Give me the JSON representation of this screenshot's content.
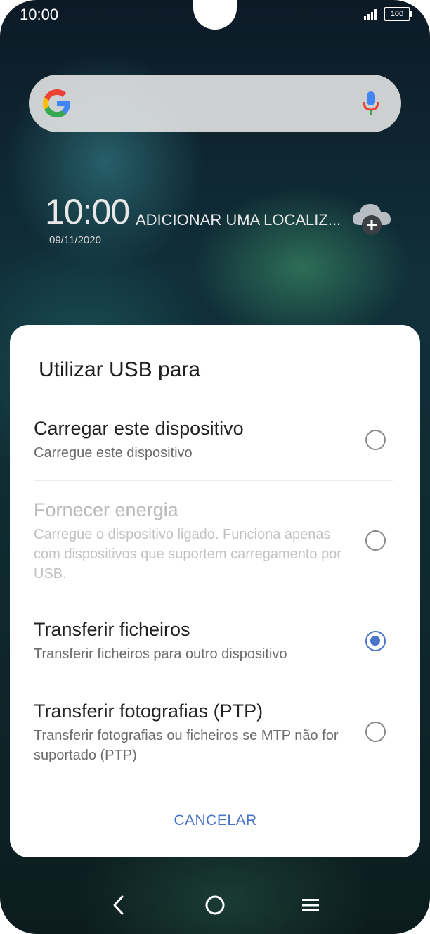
{
  "status_bar": {
    "time": "10:00",
    "battery": "100"
  },
  "home_screen": {
    "clock_time": "10:00",
    "location_prompt": "ADICIONAR UMA LOCALIZ...",
    "date": "09/11/2020"
  },
  "dialog": {
    "title": "Utilizar USB para",
    "options": [
      {
        "title": "Carregar este dispositivo",
        "subtitle": "Carregue este dispositivo",
        "selected": false,
        "enabled": true
      },
      {
        "title": "Fornecer energia",
        "subtitle": "Carregue o dispositivo ligado. Funciona apenas com dispositivos que suportem carregamento por USB.",
        "selected": false,
        "enabled": false
      },
      {
        "title": "Transferir ficheiros",
        "subtitle": "Transferir ficheiros para outro dispositivo",
        "selected": true,
        "enabled": true
      },
      {
        "title": "Transferir fotografias (PTP)",
        "subtitle": "Transferir fotografias ou ficheiros se MTP não for suportado (PTP)",
        "selected": false,
        "enabled": true
      }
    ],
    "cancel_label": "CANCELAR"
  },
  "colors": {
    "accent": "#4a74c9",
    "disabled_text": "#b8b8b8"
  },
  "icons": [
    "signal-icon",
    "battery-icon",
    "google-logo",
    "mic-icon",
    "weather-add-icon",
    "back-icon",
    "home-icon",
    "menu-icon"
  ]
}
